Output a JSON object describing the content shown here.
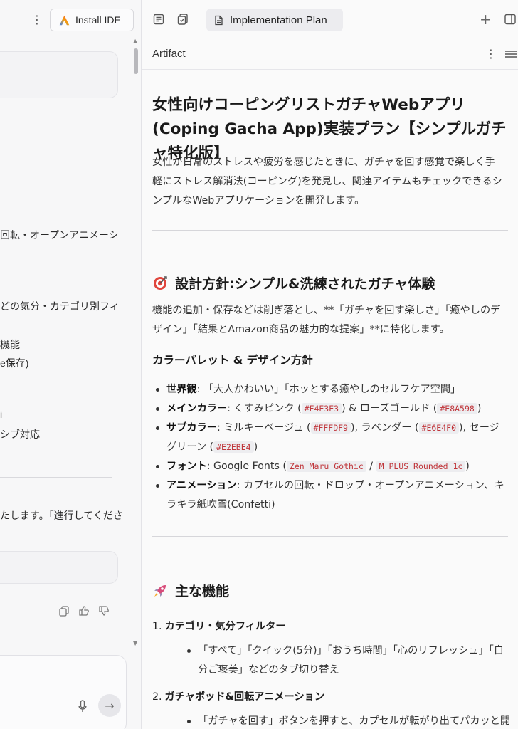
{
  "left_pane": {
    "install_label": "Install IDE",
    "fragments": [
      "回転・オープンアニメーシ",
      "どの気分・カテゴリ別フィ",
      "機能",
      "e保存)",
      "i",
      "シブ対応",
      "たします。「進行してくださ"
    ]
  },
  "tab": {
    "title": "Implementation Plan"
  },
  "artifact": {
    "label": "Artifact"
  },
  "doc": {
    "title": "女性向けコーピングリストガチャWebアプリ(Coping Gacha App)実装プラン【シンプルガチャ特化版】",
    "intro": "女性が日常のストレスや疲労を感じたときに、ガチャを回す感覚で楽しく手軽にストレス解消法(コーピング)を発見し、関連アイテムもチェックできるシンプルなWebアプリケーションを開発します。",
    "section1": {
      "heading": "設計方針:シンプル&洗練されたガチャ体験",
      "para": "機能の追加・保存などは削ぎ落とし、**「ガチャを回す楽しさ」「癒やしのデザイン」「結果とAmazon商品の魅力的な提案」**に特化します。",
      "palette_heading": "カラーパレット & デザイン方針",
      "b1_label": "世界観",
      "b1_text": ": 「大人かわいい」「ホッとする癒やしのセルフケア空間」",
      "b2_label": "メインカラー",
      "b2_pre": ": くすみピンク (",
      "b2_code1": "#F4E3E3",
      "b2_mid": ") & ローズゴールド (",
      "b2_code2": "#E8A598",
      "b2_post": ")",
      "b3_label": "サブカラー",
      "b3_pre": ": ミルキーベージュ (",
      "b3_code1": "#FFFDF9",
      "b3_mid1": "), ラベンダー (",
      "b3_code2": "#E6E4F0",
      "b3_mid2": "), セージグリーン (",
      "b3_code3": "#E2EBE4",
      "b3_post": ")",
      "b4_label": "フォント",
      "b4_pre": ": Google Fonts (",
      "b4_code1": "Zen Maru Gothic",
      "b4_mid": " / ",
      "b4_code2": "M PLUS Rounded 1c",
      "b4_post": ")",
      "b5_label": "アニメーション",
      "b5_text": ": カプセルの回転・ドロップ・オープンアニメーション、キラキラ紙吹雪(Confetti)"
    },
    "section2": {
      "heading": "主な機能",
      "item1_num": "1.",
      "item1_title": "カテゴリ・気分フィルター",
      "item1_bullet": "「すべて」「クイック(5分)」「おうち時間」「心のリフレッシュ」「自分ご褒美」などのタブ切り替え",
      "item2_num": "2.",
      "item2_title": "ガチャポッド&回転アニメーション",
      "item2_bullet": "「ガチャを回す」ボタンを押すと、カプセルが転がり出てパカッと開くア"
    }
  },
  "colors": {
    "accent_red": "#c0353a",
    "target_icon": "#e0453c",
    "rocket_icon": "#d84c7a"
  }
}
